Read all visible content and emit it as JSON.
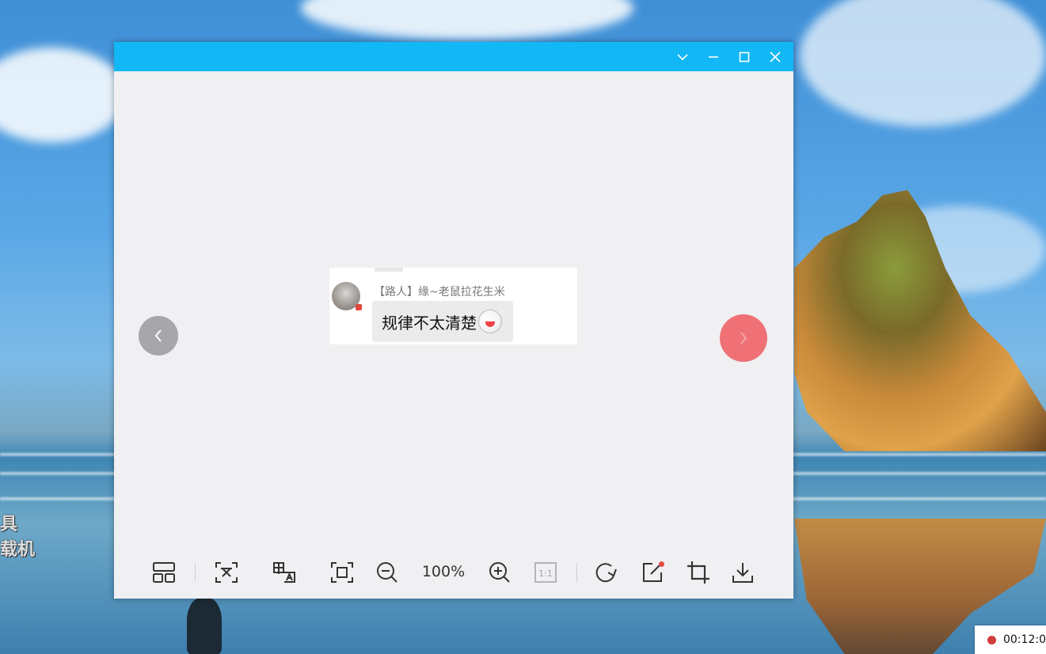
{
  "window": {
    "controls": [
      "collapse",
      "minimize",
      "maximize",
      "close"
    ]
  },
  "image": {
    "sender_name": "【路人】缘~老鼠拉花生米",
    "message_text": "规律不太清楚"
  },
  "toolbar": {
    "zoom_level": "100%",
    "one_to_one_label": "1:1"
  },
  "desktop": {
    "side_text_line1": "具",
    "side_text_line2": "载机",
    "recorder_time": "00:12:0"
  },
  "colors": {
    "titlebar": "#12b7f5",
    "next_button": "#ef6b70",
    "prev_button": "#a6a6ab",
    "record_dot": "#d33b3b"
  }
}
